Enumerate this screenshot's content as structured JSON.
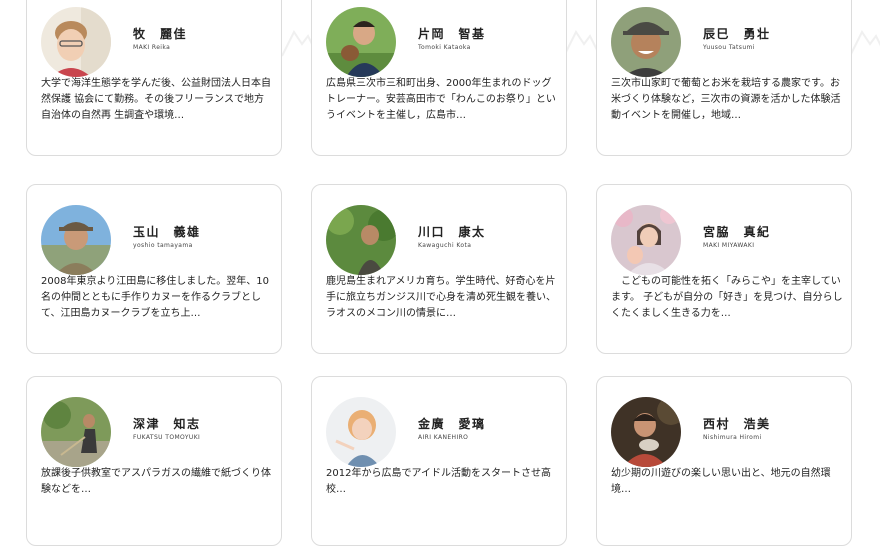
{
  "members": [
    {
      "name": "牧　麗佳",
      "romaji": "MAKI Reika",
      "bio": "大学で海洋生態学を学んだ後、公益財団法人日本自然保護 協会にて勤務。その後フリーランスで地方自治体の自然再 生調査や環境…"
    },
    {
      "name": "片岡　智基",
      "romaji": "Tomoki Kataoka",
      "bio": "広島県三次市三和町出身、2000年生まれのドッグトレーナー。安芸高田市で「わんこのお祭り」というイベントを主催し，広島市…"
    },
    {
      "name": "辰巳　勇壮",
      "romaji": "Yuusou Tatsumi",
      "bio": "三次市山家町で葡萄とお米を栽培する農家です。お米づくり体験など，三次市の資源を活かした体験活動イベントを開催し，地域…"
    },
    {
      "name": "玉山　義雄",
      "romaji": "yoshio tamayama",
      "bio": "2008年東京より江田島に移住しました。翌年、10名の仲間とともに手作りカヌーを作るクラブとして、江田島カヌークラブを立ち上…"
    },
    {
      "name": "川口　康太",
      "romaji": "Kawaguchi Kota",
      "bio": "鹿児島生まれアメリカ育ち。学生時代、好奇心を片手に旅立ちガンジス川で心身を清め死生観を養い、ラオスのメコン川の情景に…"
    },
    {
      "name": "宮脇　真紀",
      "romaji": "MAKI MIYAWAKI",
      "bio": "　こどもの可能性を拓く「みらこや」を主宰しています。 子どもが自分の「好き」を見つけ、自分らしくたくましく生きる力を…"
    },
    {
      "name": "深津　知志",
      "romaji": "FUKATSU TOMOYUKI",
      "bio": "放課後子供教室でアスパラガスの繊維で紙づくり体験などを…"
    },
    {
      "name": "金廣　愛璃",
      "romaji": "AIRI KANEHIRO",
      "bio": "2012年から広島でアイドル活動をスタートさせ高校…"
    },
    {
      "name": "西村　浩美",
      "romaji": "Nishimura Hiromi",
      "bio": "幼少期の川遊びの楽しい思い出と、地元の自然環境…"
    }
  ]
}
